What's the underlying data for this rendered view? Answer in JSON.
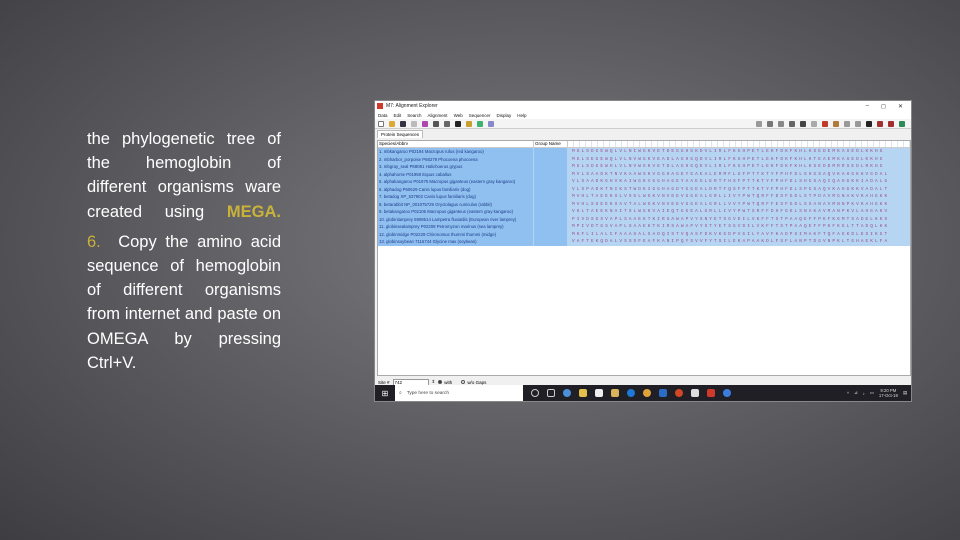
{
  "slide": {
    "para1": "the phylogenetic tree of the hemoglobin of different organisms ware created using",
    "para1_highlight": "MEGA.",
    "step_number": "6.",
    "para2": "Copy the amino acid sequence of hemoglobin of different organisms from internet and paste on OMEGA by pressing Ctrl+V."
  },
  "window": {
    "title": "M7: Alignment Explorer",
    "controls": [
      "–",
      "◻",
      "✕"
    ],
    "menu": [
      "Data",
      "Edit",
      "Search",
      "Alignment",
      "Web",
      "Sequencer",
      "Display",
      "Help"
    ],
    "tab": "Protein Sequences",
    "columns": {
      "species": "Species/Abbrv",
      "group": "Group Name"
    },
    "rows": [
      {
        "name": "1. mbkangaroo P02194 Macropus rufus (red kangaroo)",
        "seq": "MGLSDGEWQLVLNIWGKVETDEGGHGKDVLIRLFKGHPETLEKFDKFKHLKSEDEMKASEDLKKHG"
      },
      {
        "name": "2. mbharbor_porpoise P68279 Phocoena phocoena",
        "seq": "MGLSEGEWQLVLNVWGKVEADLAGHGQDVLIRLFKGHPETLEKFDKFKHLKTEAEMKASEDLKKHG"
      },
      {
        "name": "3. mbgray_seal P68081 Halichoerus grypus",
        "seq": "MGLSDGEWHLVLNVWGKVETDLAGHGQEVLIRLFKGHPETLEKFDKFKHLKSEDDMRRSEDLRKHG"
      },
      {
        "name": "4. alphahorse P01958 Equus caballus",
        "seq": "MVLSAADKTNVKAAWSKVGGHAGEYGAEALERMFLGFPTTKTYFPHFDLSHGSAQVKAHGKKVGDAL"
      },
      {
        "name": "5. alphakangaroo P01975 Macropus giganteus (eastern gray kangaroo)",
        "seq": "VLSAADKGHVKAIWGKVGGHAGEYAAEGLERTFHSFPTTKTYFPHFDLSHGSAQIQAHGKKIADALG"
      },
      {
        "name": "6. alphadog P60529 Canis lupus familiaris (dog)",
        "seq": "VLSPADKTNIKSTWDKIGGHAGDYGGEALDRTFQSFPTTKTYFPHFDLSPGSAQVKAHGKKVADALT"
      },
      {
        "name": "7. betadog XP_537902 Canis lupus familiaris (dog)",
        "seq": "MVHLTAEEKSLVSGLWGKVNVDEVGGEALGRLLIVYPWTQRFFDSFGDLSTPDAVMGNAKVKAHGKK"
      },
      {
        "name": "8. betarabbit NP_001075729 Oryctolagus cuniculus (rabbit)",
        "seq": "MVHLSSEEKSAVTALWGKVNVEEVGGEALGRLLVVYPWTQRFFESFGDLSSANAVMNNPKVKAHGKK"
      },
      {
        "name": "9. betakangaroo P02106 Macropus giganteus (eastern gray kangaroo)",
        "seq": "VHLTAEEKNAITSLWGKVAIEQTGGEALGRLLIVYPWTSRFFDHFGDLSNAKAVMANPKVLAHGAKV"
      },
      {
        "name": "10. globinlamprey 5908514 Lampetra fluviatilis (European river lamprey)",
        "seq": "PIVDSGSVAPLSAAEKTKIRSAWAPVYSNYETSGVDILVKFFTSTPAAQEFFPKFKGMTSADELKKS"
      },
      {
        "name": "11. globinsealamprey P02208 Petromyzon marinus (sea lamprey)",
        "seq": "MPIVDTGSVAPLSAAEKTKIRSAWAPVYSTYETSGVDILVKFFTSTPAAQEFFPKFKGLTTADQLKK"
      },
      {
        "name": "12. globinmidge P02229 Chironomus thummi thummi (midge)",
        "seq": "MKFLILALCFAAASALSADQISTVQASFDKVKGDPVGILYAVFKADPSIMAKFTQFAGKDLESIKGT"
      },
      {
        "name": "13. globinsoybean 7116744 Glycine max (soybean)",
        "seq": "VAFTEKQDALVSSSFEAFKANIPQYSVVFYTSILEKAPAAKDLFSFLANPTDGVNPKLTGHAEKLFA"
      }
    ],
    "status": {
      "site_label": "Site #",
      "site_value": "742",
      "with_label": "with",
      "wo_gaps_label": "w/o Gaps"
    }
  },
  "taskbar": {
    "search_placeholder": "Type here to search",
    "time": "9:20 PM",
    "date": "17-Oct-19"
  }
}
